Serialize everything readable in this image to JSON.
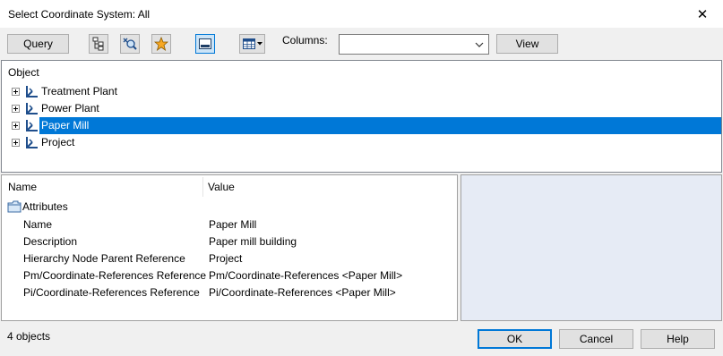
{
  "window": {
    "title": "Select Coordinate System: All",
    "close_glyph": "✕"
  },
  "toolbar": {
    "query_label": "Query",
    "columns_label": "Columns:",
    "columns_value": "",
    "view_label": "View"
  },
  "tree": {
    "header": "Object",
    "items": [
      {
        "label": "Treatment Plant",
        "selected": false
      },
      {
        "label": "Power Plant",
        "selected": false
      },
      {
        "label": "Paper Mill",
        "selected": true
      },
      {
        "label": "Project",
        "selected": false
      }
    ]
  },
  "properties": {
    "name_header": "Name",
    "value_header": "Value",
    "group_label": "Attributes",
    "rows": [
      {
        "name": "Name",
        "value": "Paper Mill"
      },
      {
        "name": "Description",
        "value": "Paper mill building"
      },
      {
        "name": "Hierarchy Node Parent Reference",
        "value": "Project"
      },
      {
        "name": "Pm/Coordinate-References Reference",
        "value": "Pm/Coordinate-References <Paper Mill>"
      },
      {
        "name": "Pi/Coordinate-References Reference",
        "value": "Pi/Coordinate-References <Paper Mill>"
      }
    ]
  },
  "footer": {
    "status": "4 objects",
    "ok_label": "OK",
    "cancel_label": "Cancel",
    "help_label": "Help"
  },
  "colors": {
    "selection": "#0078d7",
    "preview_bg": "#e6ebf5",
    "icon_blue": "#1f4e8c"
  },
  "icons": {
    "tree_item": "coordinate-system-icon",
    "group": "folder-icon"
  }
}
